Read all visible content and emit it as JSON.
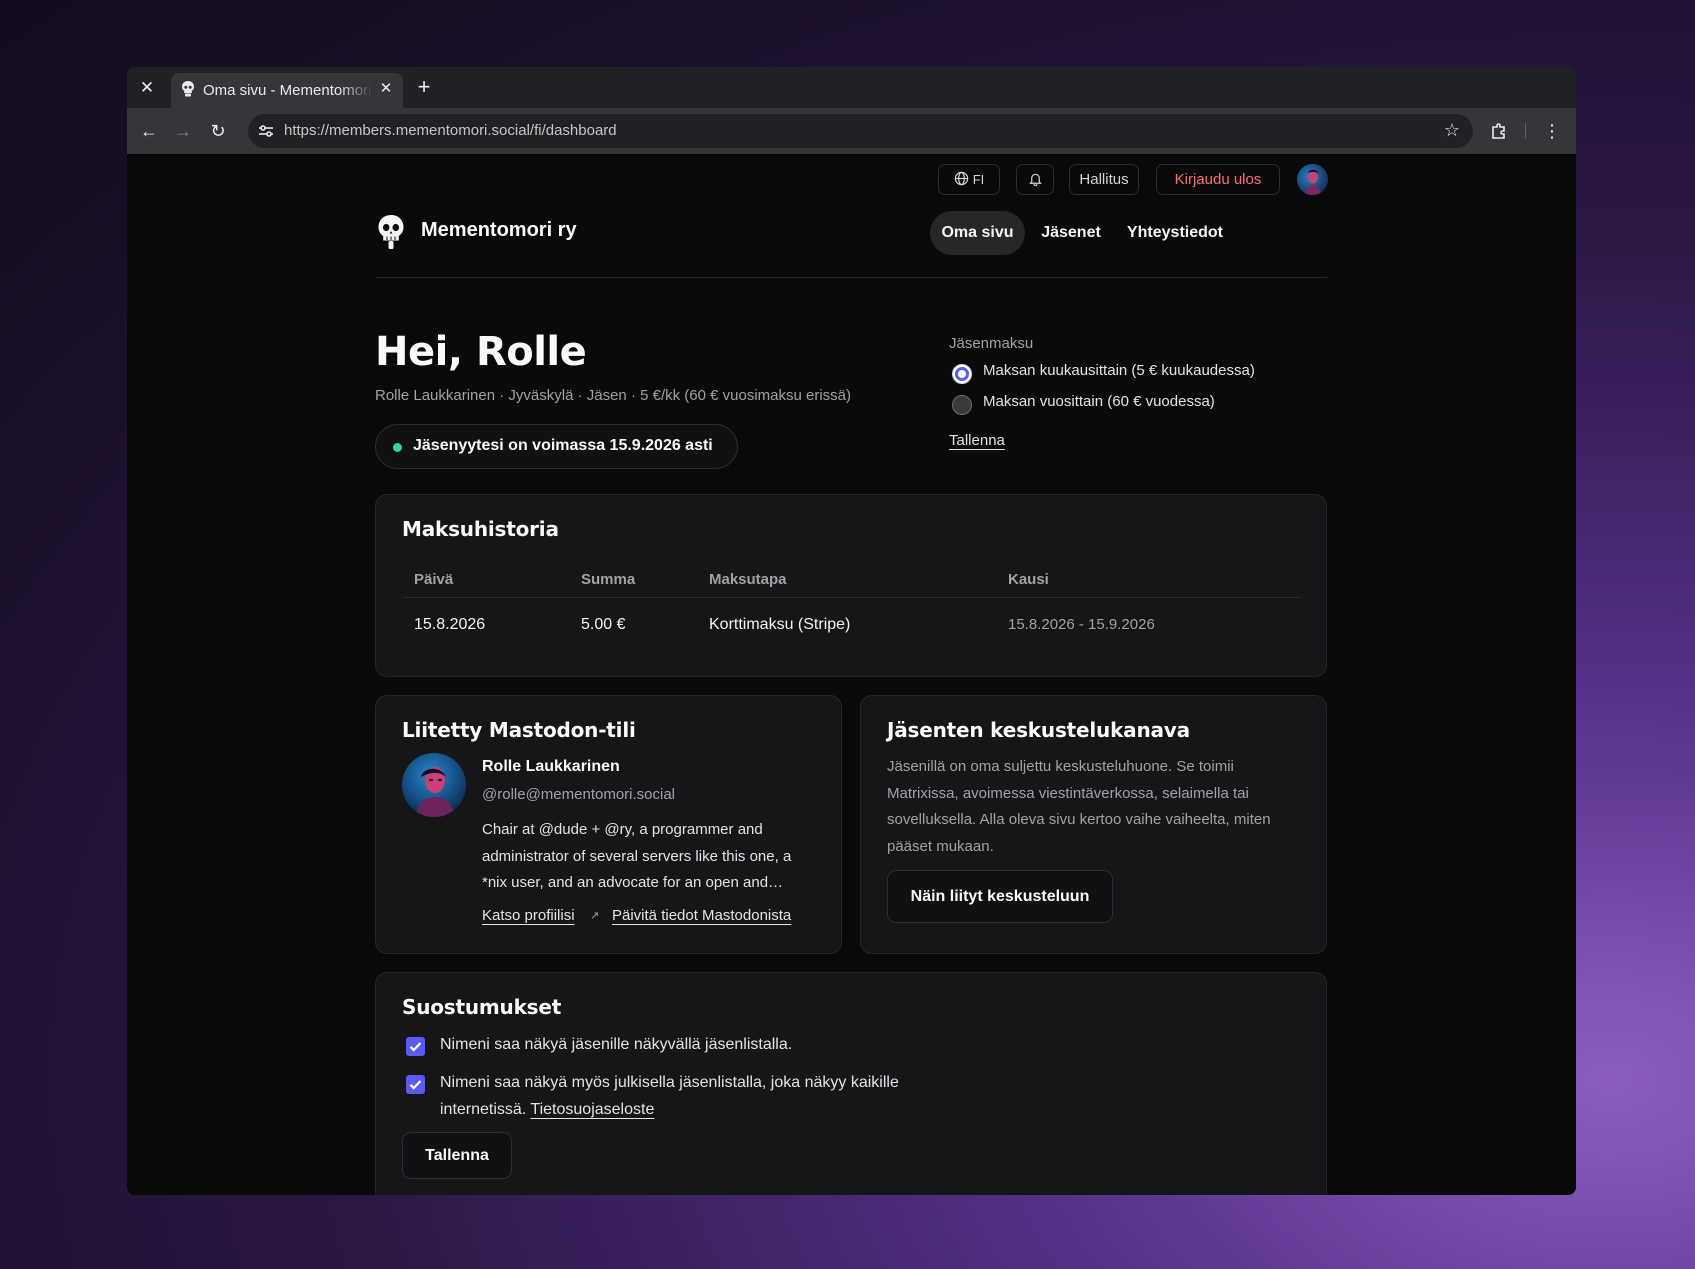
{
  "browser": {
    "tab_title": "Oma sivu - Mementomori ry",
    "url": "https://members.mementomori.social/fi/dashboard"
  },
  "utility": {
    "language": "FI",
    "admin": "Hallitus",
    "logout": "Kirjaudu ulos"
  },
  "site": {
    "brand": "Mementomori ry",
    "nav": [
      "Oma sivu",
      "Jäsenet",
      "Yhteystiedot"
    ]
  },
  "hero": {
    "greeting": "Hei, Rolle",
    "meta": "Rolle Laukkarinen · Jyväskylä · Jäsen · 5 €/kk (60 € vuosimaksu erissä)",
    "status": "Jäsenyytesi on voimassa 15.9.2026 asti"
  },
  "fee": {
    "label": "Jäsenmaksu",
    "options": [
      "Maksan kuukausittain (5 € kuukaudessa)",
      "Maksan vuosittain (60 € vuodessa)"
    ],
    "selected": "Maksan kuukausittain (5 € kuukaudessa)",
    "save": "Tallenna"
  },
  "payments": {
    "title": "Maksuhistoria",
    "headers": [
      "Päivä",
      "Summa",
      "Maksutapa",
      "Kausi"
    ],
    "rows": [
      [
        "15.8.2026",
        "5.00 €",
        "Korttimaksu (Stripe)",
        "15.8.2026 - 15.9.2026"
      ]
    ]
  },
  "mastodon": {
    "title": "Liitetty Mastodon-tili",
    "name": "Rolle Laukkarinen",
    "handle": "@rolle@mementomori.social",
    "bio": "Chair at @dude + @ry, a programmer and administrator of several servers like this one, a *nix user, and an advocate for an open and…",
    "view_profile": "Katso profiilisi",
    "update": "Päivitä tiedot Mastodonista"
  },
  "chat": {
    "title": "Jäsenten keskustelukanava",
    "text": "Jäsenillä on oma suljettu keskusteluhuone. Se toimii Matrixissa, avoimessa viestintäverkossa, selaimella tai sovelluksella. Alla oleva sivu kertoo vaihe vaiheelta, miten pääset mukaan.",
    "button": "Näin liityt keskusteluun"
  },
  "consents": {
    "title": "Suostumukset",
    "items": [
      {
        "text": "Nimeni saa näkyä jäsenille näkyvällä jäsenlistalla.",
        "checked": true
      },
      {
        "text": "Nimeni saa näkyä myös julkisella jäsenlistalla, joka näkyy kaikille internetissä.",
        "checked": true
      }
    ],
    "privacy_link": "Tietosuojaseloste",
    "save": "Tallenna"
  },
  "colors": {
    "accent": "#5b5bf0",
    "logout": "#f87171",
    "status_ok": "#34d399",
    "background": "#0a0a0b",
    "card": "#161618"
  },
  "icons": [
    "close-icon",
    "skull-icon",
    "plus-icon",
    "back-icon",
    "forward-icon",
    "reload-icon",
    "tune-icon",
    "star-icon",
    "extensions-icon",
    "menu-icon",
    "globe-icon",
    "bell-icon",
    "external-link-icon",
    "check-icon"
  ]
}
